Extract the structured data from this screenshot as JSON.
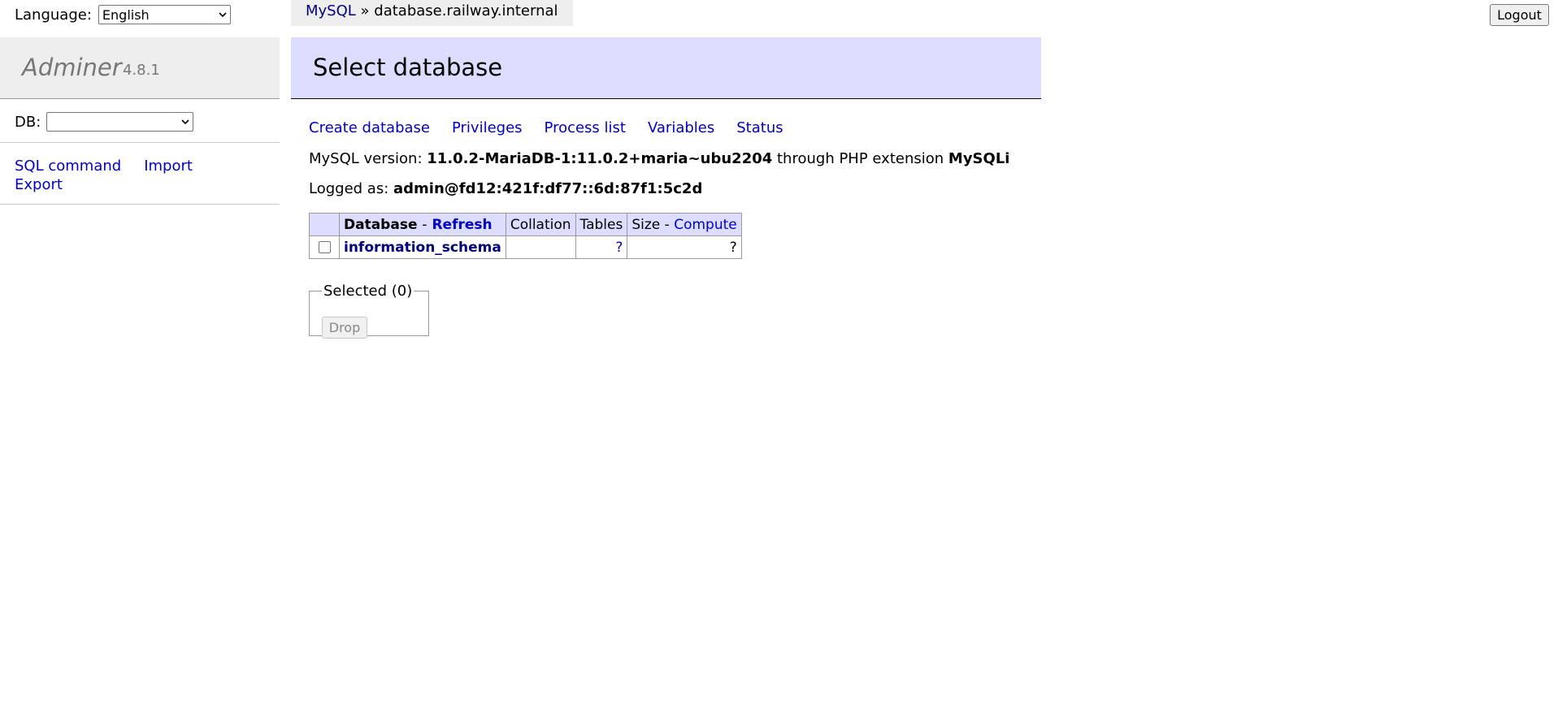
{
  "menu": {
    "language_label": "Language:",
    "language_value": "English",
    "brand": "Adminer",
    "version": "4.8.1",
    "db_label": "DB:",
    "db_value": "",
    "links": [
      "SQL command",
      "Import",
      "Export"
    ]
  },
  "breadcrumb": {
    "driver": "MySQL",
    "separator": "»",
    "server": "database.railway.internal"
  },
  "logout_label": "Logout",
  "content": {
    "title": "Select database",
    "links": [
      "Create database",
      "Privileges",
      "Process list",
      "Variables",
      "Status"
    ],
    "version_label": "MySQL version:",
    "version_value": "11.0.2-MariaDB-1:11.0.2+maria~ubu2204",
    "through_text": "through PHP extension",
    "extension": "MySQLi",
    "logged_label": "Logged as:",
    "logged_value": "admin@fd12:421f:df77::6d:87f1:5c2d"
  },
  "table": {
    "headers": {
      "database": "Database",
      "dash": "-",
      "refresh": "Refresh",
      "collation": "Collation",
      "tables": "Tables",
      "size": "Size",
      "compute": "Compute"
    },
    "rows": [
      {
        "name": "information_schema",
        "collation": "",
        "tables": "?",
        "size": "?"
      }
    ]
  },
  "selection": {
    "legend": "Selected (0)",
    "drop_label": "Drop"
  }
}
